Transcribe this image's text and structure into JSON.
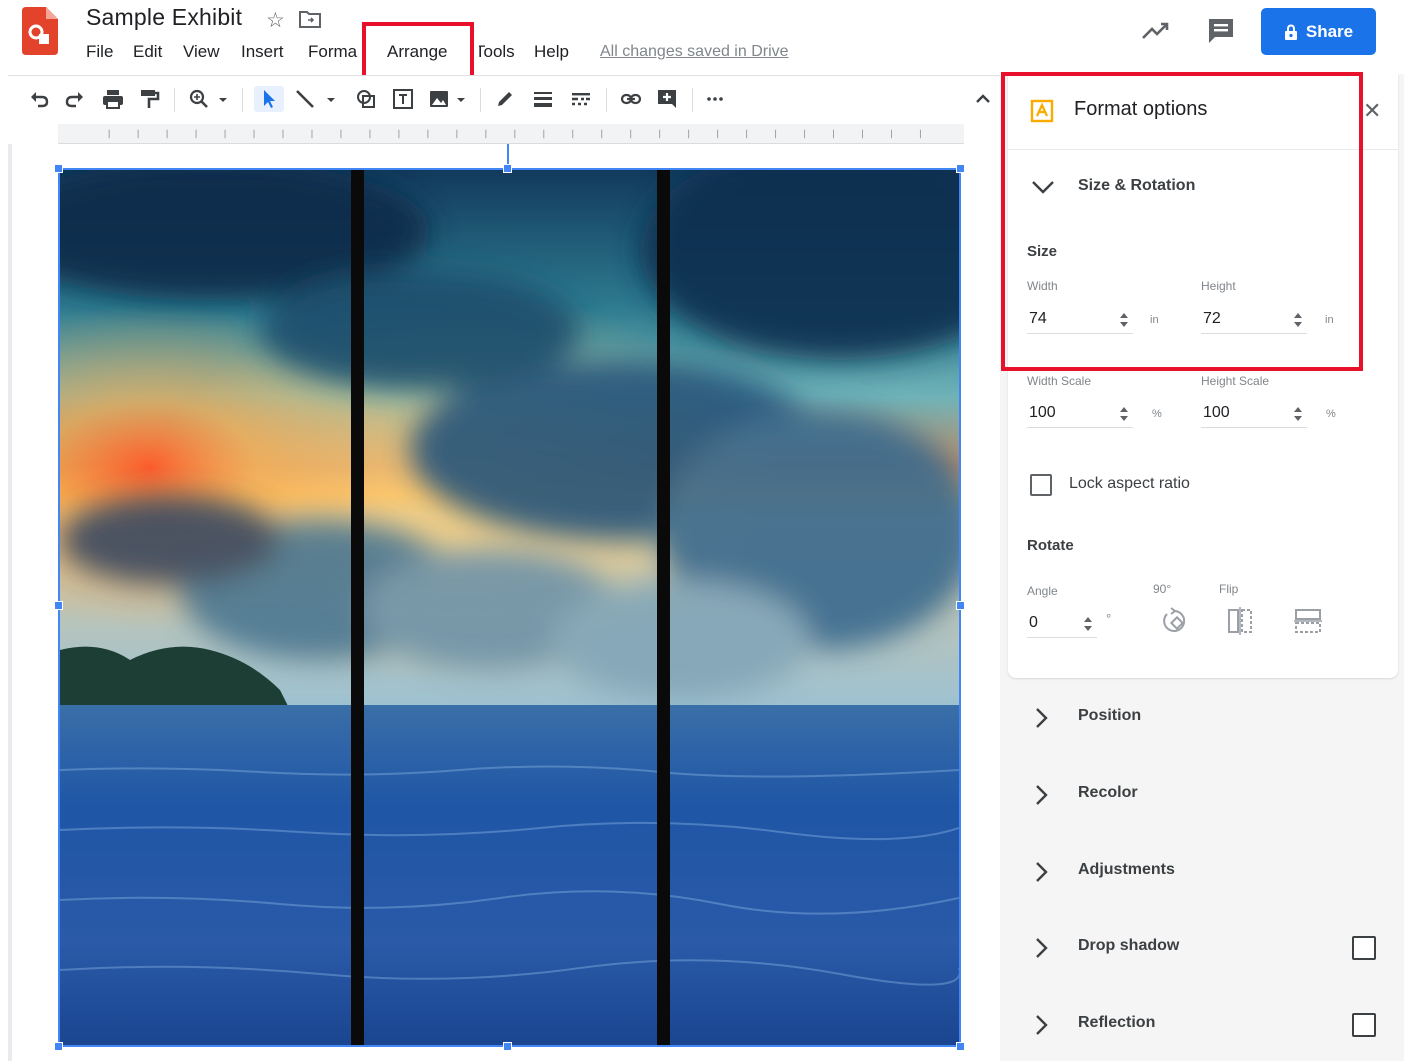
{
  "app": {
    "doc_title": "Sample Exhibit",
    "saved_status": "All changes saved in Drive",
    "menu": [
      "File",
      "Edit",
      "View",
      "Insert",
      "Forma",
      "Arrange",
      "Tools",
      "Help"
    ],
    "share_label": "Share",
    "icons": {
      "logo": "google-drawings-logo",
      "star": "star-icon",
      "folder": "move-to-folder-icon",
      "activity": "activity-trend-icon",
      "comments": "comment-icon",
      "share": "lock-icon"
    },
    "accent_color": "#1a73e8",
    "highlight_color": "#e8102a"
  },
  "toolbar": {
    "tools": [
      "undo-icon",
      "redo-icon",
      "print-icon",
      "paint-format-icon",
      "zoom-icon",
      "select-icon",
      "line-icon",
      "shape-icon",
      "text-box-icon",
      "image-icon",
      "pen-icon",
      "line-weight-icon",
      "line-dash-icon",
      "link-icon",
      "add-comment-icon",
      "more-icon",
      "collapse-icon"
    ]
  },
  "format_panel": {
    "title": "Format options",
    "section": "Size & Rotation",
    "size": {
      "heading": "Size",
      "width_label": "Width",
      "width_value": "74",
      "width_unit": "in",
      "height_label": "Height",
      "height_value": "72",
      "height_unit": "in",
      "width_scale_label": "Width Scale",
      "width_scale_value": "100",
      "width_scale_unit": "%",
      "height_scale_label": "Height Scale",
      "height_scale_value": "100",
      "height_scale_unit": "%"
    },
    "lock_aspect_label": "Lock aspect ratio",
    "lock_aspect_checked": false,
    "rotate": {
      "heading": "Rotate",
      "angle_label": "Angle",
      "angle_value": "0",
      "angle_unit": "°",
      "ninety_label": "90°",
      "flip_label": "Flip"
    },
    "collapsed_sections": [
      {
        "label": "Position",
        "checkbox": false
      },
      {
        "label": "Recolor",
        "checkbox": false
      },
      {
        "label": "Adjustments",
        "checkbox": false
      },
      {
        "label": "Drop shadow",
        "checkbox": true
      },
      {
        "label": "Reflection",
        "checkbox": true
      }
    ]
  }
}
